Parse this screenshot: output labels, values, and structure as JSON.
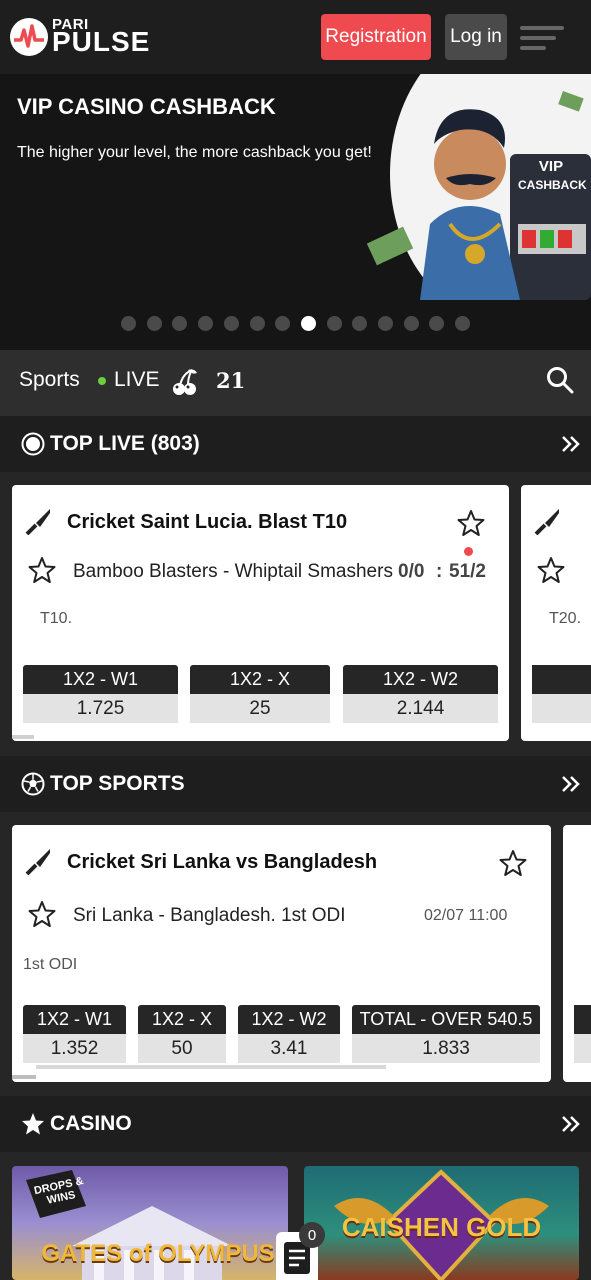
{
  "header": {
    "logo_top": "PARI",
    "logo_bottom": "PULSE",
    "register_label": "Registration",
    "login_label": "Log in",
    "menu_icon": "hamburger-icon"
  },
  "banner": {
    "title": "VIP CASINO CASHBACK",
    "subtitle": "The higher your level, the more cashback you get!",
    "sign_line1": "VIP",
    "sign_line2": "CASHBACK",
    "slide_count": 14,
    "active_slide": 8
  },
  "nav": {
    "sports": "Sports",
    "live": "LIVE",
    "twentyone": "21",
    "cherry_icon": "cherries-icon",
    "search_icon": "search-icon"
  },
  "top_live": {
    "title": "TOP LIVE (803)",
    "icon": "live-circle-icon",
    "card": {
      "league": "Cricket Saint Lucia. Blast T10",
      "teams": "Bamboo Blasters - Whiptail Smashers",
      "score_left": "0/0",
      "score_sep": ":",
      "score_right": "51/2",
      "format": "T10.",
      "odds": [
        {
          "label": "1X2 - W1",
          "value": "1.725"
        },
        {
          "label": "1X2 - X",
          "value": "25"
        },
        {
          "label": "1X2 - W2",
          "value": "2.144"
        }
      ]
    },
    "peek_card": {
      "format": "T20."
    }
  },
  "top_sports": {
    "title": "TOP SPORTS",
    "icon": "soccer-ball-icon",
    "card": {
      "league": "Cricket Sri Lanka vs Bangladesh",
      "teams": "Sri Lanka - Bangladesh. 1st ODI",
      "datetime": "02/07 11:00",
      "format": "1st ODI",
      "odds": [
        {
          "label": "1X2 - W1",
          "value": "1.352"
        },
        {
          "label": "1X2 - X",
          "value": "50"
        },
        {
          "label": "1X2 - W2",
          "value": "3.41"
        },
        {
          "label": "TOTAL - OVER 540.5",
          "value": "1.833"
        }
      ]
    }
  },
  "casino": {
    "title": "CASINO",
    "icon": "star-icon",
    "tiles": [
      {
        "badge": "DROPS & WINS",
        "name": "GATES of OLYMPUS"
      },
      {
        "name": "CAISHEN GOLD"
      }
    ],
    "betslip_count": "0"
  },
  "colors": {
    "accent_red": "#ee4a4f",
    "live_green": "#6ccf3c",
    "background": "#262626"
  }
}
